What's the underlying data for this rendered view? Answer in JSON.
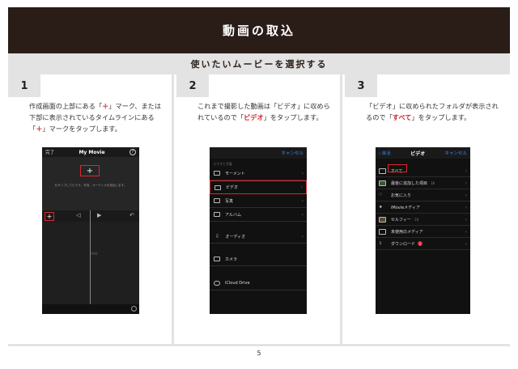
{
  "header": {
    "title": "動画の取込"
  },
  "subheader": {
    "title": "使いたいムービーを選択する"
  },
  "steps": [
    {
      "number": "1",
      "desc_a": "作成画面の上部にある「",
      "desc_b": "＋",
      "desc_c": "」マーク、または下部に表示されているタイムラインにある「",
      "desc_d": "＋",
      "desc_e": "」マークをタップします。",
      "phone": {
        "done": "完了",
        "title": "My Movie",
        "help": "?",
        "plus": "+",
        "hint": "をタップしてビデオ、写真、オーディオを追加します。",
        "gap": "000"
      }
    },
    {
      "number": "2",
      "desc_a": "これまで撮影した動画は「ビデオ」に収められているので「",
      "desc_b": "ビデオ",
      "desc_c": "」をタップします。",
      "phone": {
        "cancel": "キャンセル",
        "section": "ビデオと写真",
        "rows": [
          "モーメント",
          "ビデオ",
          "写真",
          "アルバム"
        ],
        "rows2": [
          "オーディオ"
        ],
        "rows3": [
          "カメラ"
        ],
        "rows4": [
          "iCloud Drive"
        ]
      }
    },
    {
      "number": "3",
      "desc_a": "「ビデオ」に収められたフォルダが表示されるので「",
      "desc_b": "すべて",
      "desc_c": "」をタップします。",
      "phone": {
        "back": "戻る",
        "title": "ビデオ",
        "cancel": "キャンセル",
        "rows": [
          {
            "label": "すべて",
            "count": ""
          },
          {
            "label": "最後に追加した項目",
            "count": "38"
          },
          {
            "label": "お気に入り",
            "count": ""
          },
          {
            "label": "iMovieメディア",
            "count": ""
          },
          {
            "label": "セルフィー",
            "count": "18"
          },
          {
            "label": "未使用のメディア",
            "count": ""
          },
          {
            "label": "ダウンロード",
            "count": ""
          }
        ],
        "badge": "1"
      }
    }
  ],
  "page_number": "5",
  "colors": {
    "header_bg": "#2a1d17",
    "accent": "#d0242b",
    "link": "#2f8cff"
  }
}
